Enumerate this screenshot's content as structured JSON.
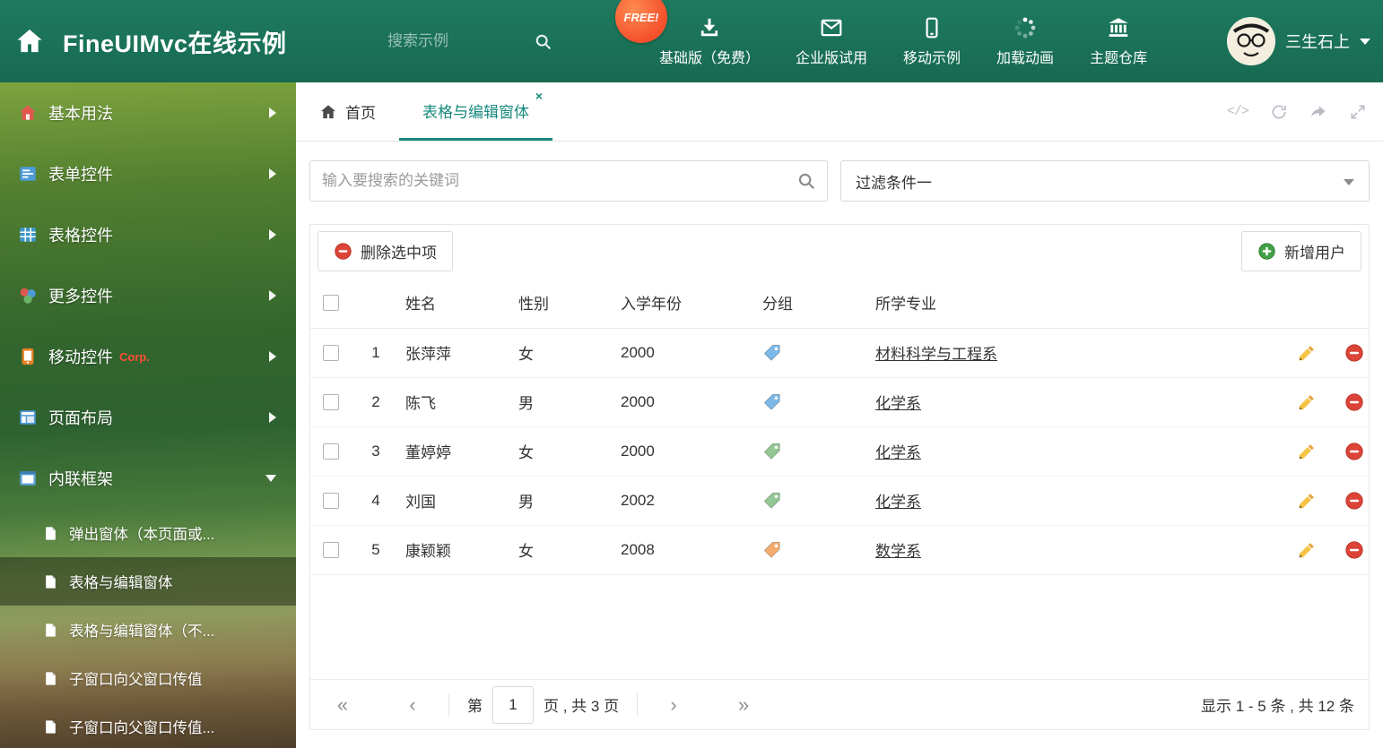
{
  "header": {
    "title": "FineUIMvc在线示例",
    "search_placeholder": "搜索示例",
    "free_badge": "FREE!",
    "nav_items": [
      {
        "label": "基础版（免费）",
        "icon": "download-icon"
      },
      {
        "label": "企业版试用",
        "icon": "envelope-icon"
      },
      {
        "label": "移动示例",
        "icon": "mobile-icon"
      },
      {
        "label": "加载动画",
        "icon": "spinner-icon"
      },
      {
        "label": "主题仓库",
        "icon": "bank-icon"
      }
    ],
    "user": {
      "name": "三生石上"
    }
  },
  "sidebar": {
    "items": [
      {
        "label": "基本用法"
      },
      {
        "label": "表单控件"
      },
      {
        "label": "表格控件"
      },
      {
        "label": "更多控件"
      },
      {
        "label": "移动控件",
        "badge": "Corp."
      },
      {
        "label": "页面布局"
      },
      {
        "label": "内联框架",
        "expanded": true,
        "children": [
          {
            "label": "弹出窗体（本页面或..."
          },
          {
            "label": "表格与编辑窗体",
            "active": true
          },
          {
            "label": "表格与编辑窗体（不..."
          },
          {
            "label": "子窗口向父窗口传值"
          },
          {
            "label": "子窗口向父窗口传值..."
          }
        ]
      }
    ]
  },
  "tabs": [
    {
      "label": "首页"
    },
    {
      "label": "表格与编辑窗体",
      "active": true,
      "close_icon": "×"
    }
  ],
  "tab_tools": {
    "code_icon": "</>"
  },
  "main": {
    "search_placeholder": "输入要搜索的关键词",
    "filter_value": "过滤条件一",
    "toolbar": {
      "delete_label": "删除选中项",
      "add_label": "新增用户"
    },
    "table": {
      "columns": [
        "姓名",
        "性别",
        "入学年份",
        "分组",
        "所学专业"
      ],
      "rows": [
        {
          "index": 1,
          "name": "张萍萍",
          "gender": "女",
          "year": "2000",
          "tag_color": "#7db9e8",
          "major": "材料科学与工程系"
        },
        {
          "index": 2,
          "name": "陈飞",
          "gender": "男",
          "year": "2000",
          "tag_color": "#7db9e8",
          "major": "化学系"
        },
        {
          "index": 3,
          "name": "董婷婷",
          "gender": "女",
          "year": "2000",
          "tag_color": "#94c794",
          "major": "化学系"
        },
        {
          "index": 4,
          "name": "刘国",
          "gender": "男",
          "year": "2002",
          "tag_color": "#94c794",
          "major": "化学系"
        },
        {
          "index": 5,
          "name": "康颖颖",
          "gender": "女",
          "year": "2008",
          "tag_color": "#f3ad6f",
          "major": "数学系"
        }
      ]
    },
    "pagination": {
      "first_icon": "«",
      "prev_icon": "‹",
      "next_icon": "›",
      "last_icon": "»",
      "page_prefix": "第",
      "current_page": "1",
      "page_suffix": "页 , 共 3 页",
      "summary": "显示 1 - 5 条 , 共 12 条"
    }
  },
  "colors": {
    "header_green": "#1b7257",
    "accent_teal": "#17897c",
    "delete_red": "#db4437",
    "add_green": "#43a047",
    "pencil_yellow": "#f6c445"
  }
}
